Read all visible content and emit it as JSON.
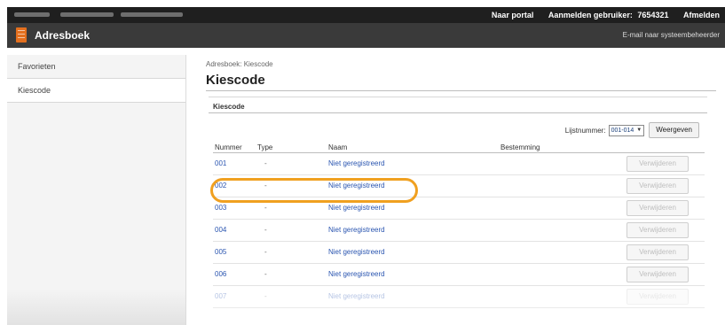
{
  "topbar": {
    "portal_link": "Naar portal",
    "login_label": "Aanmelden gebruiker:",
    "user_id": "7654321",
    "logout_link": "Afmelden"
  },
  "app": {
    "title": "Adresboek",
    "mail_link": "E-mail naar systeembeheerder",
    "logo_icon": "address-book-icon"
  },
  "sidebar": {
    "items": [
      {
        "label": "Favorieten"
      },
      {
        "label": "Kiescode"
      }
    ]
  },
  "main": {
    "breadcrumb": "Adresboek: Kiescode",
    "title": "Kiescode",
    "section_title": "Kiescode",
    "list_label": "Lijstnummer:",
    "list_value": "001-014",
    "show_button": "Weergeven",
    "columns": [
      "Nummer",
      "Type",
      "Naam",
      "Bestemming"
    ],
    "rows": [
      {
        "number": "001",
        "type": "-",
        "name": "Niet geregistreerd",
        "action": "Verwijderen"
      },
      {
        "number": "002",
        "type": "-",
        "name": "Niet geregistreerd",
        "action": "Verwijderen"
      },
      {
        "number": "003",
        "type": "-",
        "name": "Niet geregistreerd",
        "action": "Verwijderen"
      },
      {
        "number": "004",
        "type": "-",
        "name": "Niet geregistreerd",
        "action": "Verwijderen"
      },
      {
        "number": "005",
        "type": "-",
        "name": "Niet geregistreerd",
        "action": "Verwijderen"
      },
      {
        "number": "006",
        "type": "-",
        "name": "Niet geregistreerd",
        "action": "Verwijderen"
      },
      {
        "number": "007",
        "type": "-",
        "name": "Niet geregistreerd",
        "action": "Verwijderen"
      }
    ]
  },
  "colors": {
    "accent": "#e36f1e",
    "highlight": "#f0a020",
    "link": "#2a55b0"
  }
}
